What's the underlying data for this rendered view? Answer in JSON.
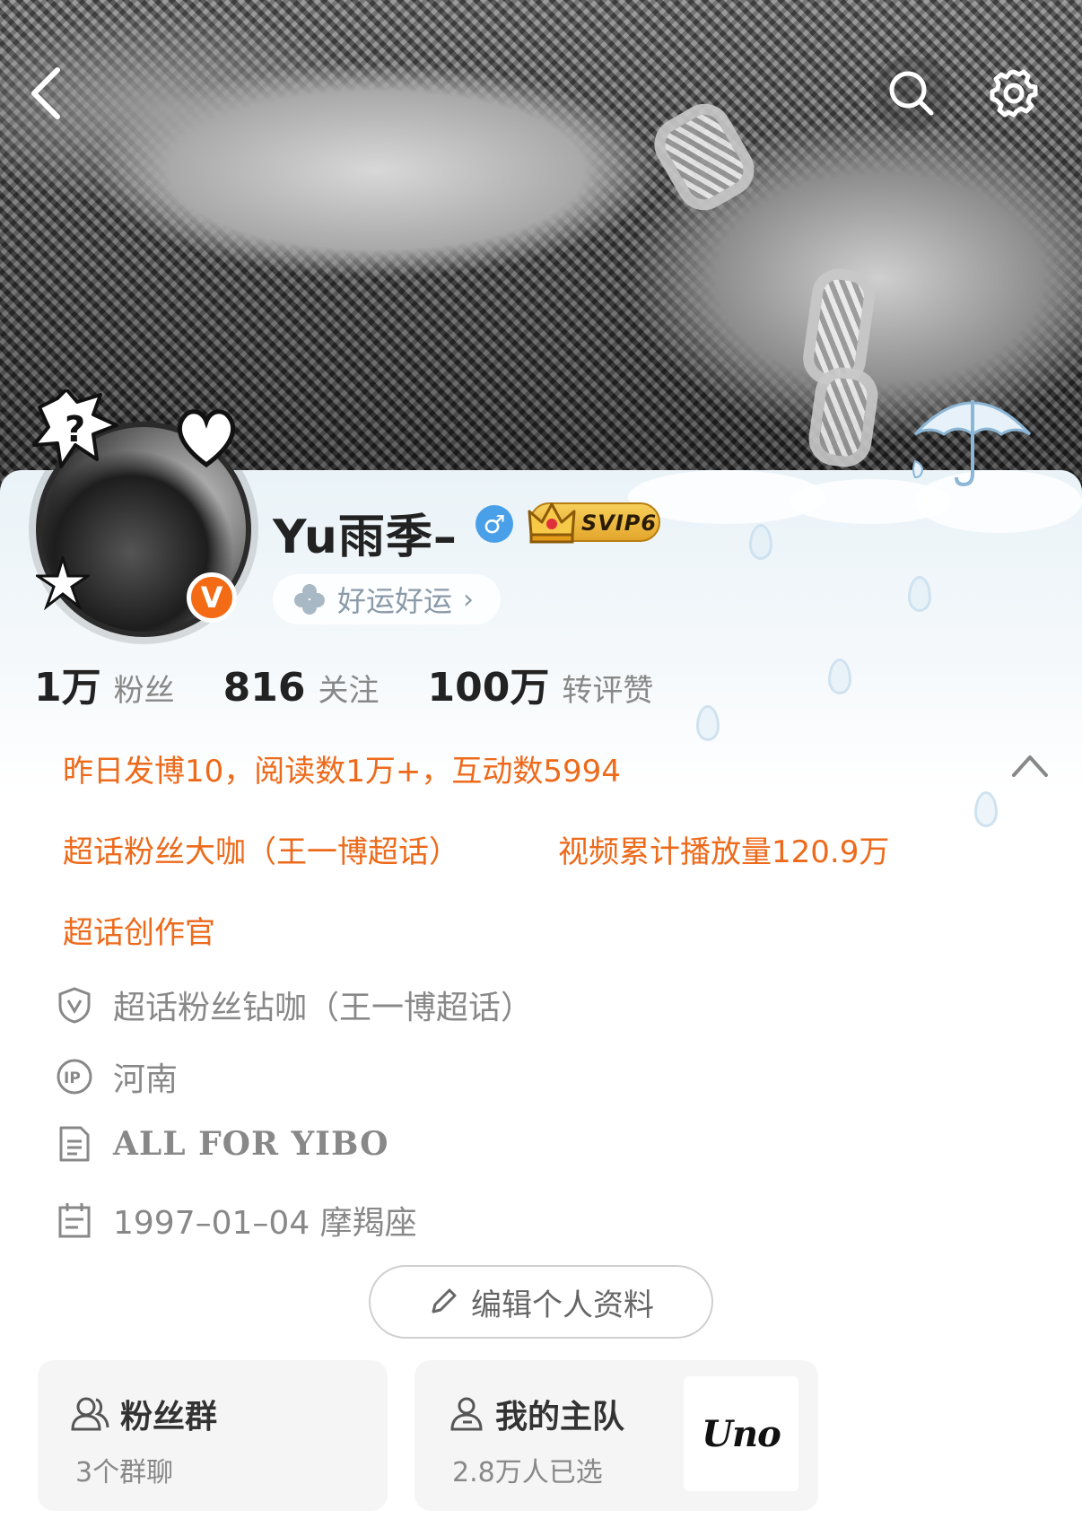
{
  "profile": {
    "name": "Yu雨季–",
    "gender_symbol": "♂",
    "vip_label": "SVIP6",
    "verified_symbol": "V",
    "luck_label": "好运好运",
    "luck_chevron": "›"
  },
  "stats": [
    {
      "value": "1万",
      "label": "粉丝"
    },
    {
      "value": "816",
      "label": "关注"
    },
    {
      "value": "100万",
      "label": "转评赞"
    }
  ],
  "highlights": {
    "yesterday": "昨日发博10，阅读数1万+，互动数5994",
    "supertopic_fan": "超话粉丝大咖（王一博超话）",
    "video_plays": "视频累计播放量120.9万",
    "creator": "超话创作官"
  },
  "details": {
    "badge": "超话粉丝钻咖（王一博超话）",
    "ip_location": "河南",
    "bio": "ALL FOR YIBO",
    "birthday": "1997–01–04 摩羯座"
  },
  "edit_button_label": "编辑个人资料",
  "cards": {
    "fan_group": {
      "title": "粉丝群",
      "subtitle": "3个群聊"
    },
    "main_team": {
      "title": "我的主队",
      "subtitle": "2.8万人已选",
      "logo_text": "Uno"
    }
  },
  "icons": {
    "back": "chevron-left-icon",
    "search": "search-icon",
    "settings": "gear-icon",
    "collapse": "chevron-up-icon"
  },
  "colors": {
    "accent_orange": "#ed6a1b",
    "verified_orange": "#f36b15",
    "gender_blue": "#4aa0e8",
    "svip_gold": "#e4a62c"
  }
}
